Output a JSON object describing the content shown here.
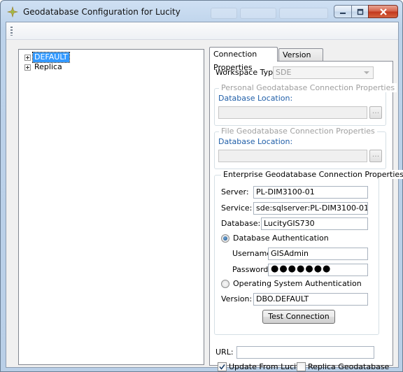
{
  "window": {
    "title": "Geodatabase Configuration for Lucity",
    "controls": {
      "minimize_icon": "minimize-icon",
      "maximize_icon": "maximize-icon",
      "close_icon": "close-icon"
    }
  },
  "tree": {
    "nodes": [
      {
        "label": "DEFAULT",
        "selected": true
      },
      {
        "label": "Replica",
        "selected": false
      }
    ]
  },
  "tabs": [
    {
      "label": "Connection Properties",
      "active": true
    },
    {
      "label": "Version Setup",
      "active": false
    }
  ],
  "connection": {
    "workspace_type_label": "Workspace Type:",
    "workspace_type_value": "SDE",
    "personal": {
      "title": "Personal Geodatabase Connection Properties",
      "db_location_label": "Database Location:",
      "browse_label": "..."
    },
    "file": {
      "title": "File Geodatabase Connection Properties",
      "db_location_label": "Database Location:",
      "browse_label": "..."
    },
    "enterprise": {
      "title": "Enterprise Geodatabase Connection Properties",
      "server_label": "Server:",
      "server_value": "PL-DIM3100-01",
      "service_label": "Service:",
      "service_value": "sde:sqlserver:PL-DIM3100-01",
      "database_label": "Database:",
      "database_value": "LucityGIS730",
      "db_auth_label": "Database Authentication",
      "username_label": "Username:",
      "username_value": "GISAdmin",
      "password_label": "Password:",
      "password_value": "●●●●●●●",
      "os_auth_label": "Operating System Authentication",
      "version_label": "Version:",
      "version_value": "DBO.DEFAULT",
      "test_button": "Test Connection"
    },
    "url_label": "URL:",
    "url_value": "",
    "update_from_lucity_label": "Update From Lucity",
    "update_from_lucity_checked": true,
    "replica_geodatabase_label": "Replica Geodatabase",
    "replica_geodatabase_checked": false
  }
}
